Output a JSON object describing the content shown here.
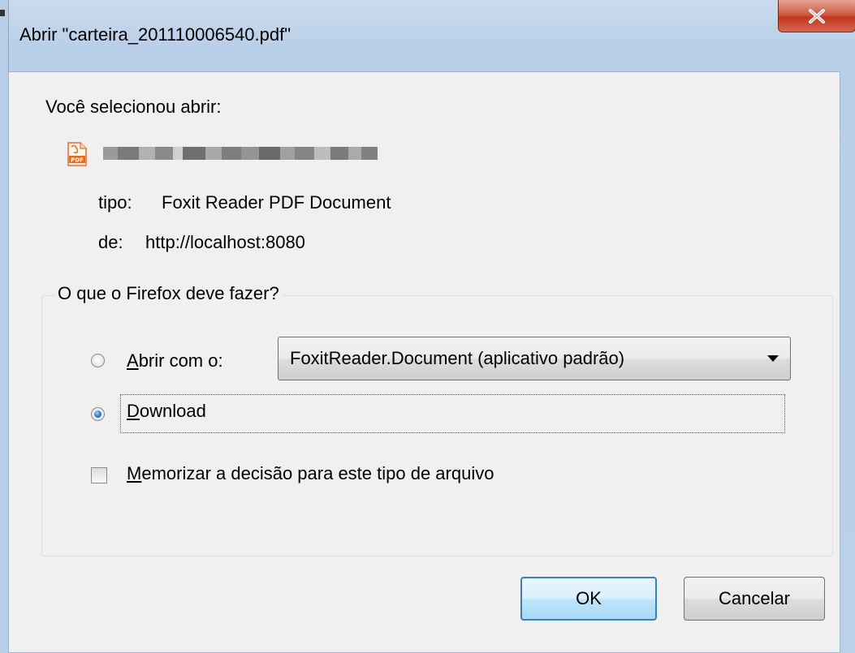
{
  "window": {
    "title": "Abrir \"carteira_201110006540.pdf\"",
    "close_symbol": "X"
  },
  "content": {
    "intro": "Você selecionou abrir:",
    "file_icon": "pdf-file-icon",
    "type_label": "tipo:",
    "type_value": "Foxit Reader PDF Document",
    "from_label": "de:",
    "from_value": "http://localhost:8080"
  },
  "action_group": {
    "legend": "O que o Firefox deve fazer?",
    "open_with_label": "Abrir com o:",
    "open_with_selected": false,
    "open_with_app": "FoxitReader.Document (aplicativo padrão)",
    "download_label": "Download",
    "download_selected": true,
    "remember_label": "Memorizar a decisão para este tipo de arquivo",
    "remember_checked": false
  },
  "buttons": {
    "ok": "OK",
    "cancel": "Cancelar"
  }
}
